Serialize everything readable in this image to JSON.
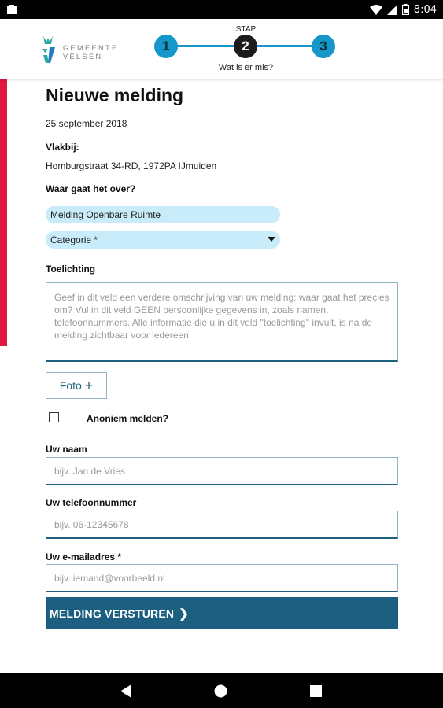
{
  "status_bar": {
    "time": "8:04"
  },
  "header": {
    "logo_text_line1": "GEMEENTE",
    "logo_text_line2": "VELSEN",
    "stepper": {
      "top_label": "STAP",
      "steps": [
        "1",
        "2",
        "3"
      ],
      "active_step": 2,
      "sub_label": "Wat is er mis?"
    }
  },
  "colors": {
    "accent_blue": "#1598c9",
    "accent_red": "#e0173f",
    "button_blue": "#1c5f80",
    "pill_bg": "#c9ecfb"
  },
  "form": {
    "title": "Nieuwe melding",
    "date": "25 september 2018",
    "near_label": "Vlakbij:",
    "address": "Homburgstraat 34-RD, 1972PA IJmuiden",
    "topic_label": "Waar gaat het over?",
    "topic_value": "Melding Openbare Ruimte",
    "category_placeholder": "Categorie *",
    "explanation_label": "Toelichting",
    "explanation_placeholder": "Geef in dit veld een verdere omschrijving van uw melding: waar gaat het precies om? Vul in dit veld GEEN persoonlijke gegevens in, zoals namen, telefoonnummers. Alle informatie die u in dit veld \"toelichting\" invult, is na de melding zichtbaar voor iedereen",
    "photo_button": "Foto",
    "anonymous_label": "Anoniem melden?",
    "anonymous_checked": false,
    "name_label": "Uw naam",
    "name_placeholder": "bijv. Jan de Vries",
    "phone_label": "Uw telefoonnummer",
    "phone_placeholder": "bijv. 06-12345678",
    "email_label": "Uw e-mailadres *",
    "email_placeholder": "bijv. iemand@voorbeeld.nl",
    "submit_label": "MELDING VERSTUREN"
  }
}
